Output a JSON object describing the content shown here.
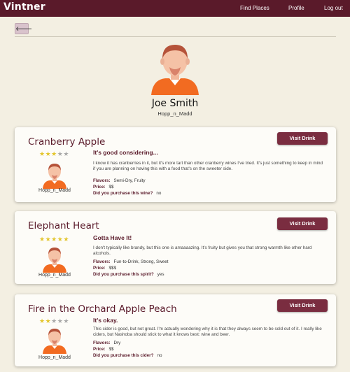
{
  "app": {
    "brand": "Vintner"
  },
  "nav": {
    "find_places": "Find Places",
    "profile": "Profile",
    "logout": "Log out"
  },
  "back_button": {
    "icon": "arrow-left-icon",
    "glyph": "🡐"
  },
  "profile": {
    "name": "Joe Smith",
    "handle": "Hopp_n_Madd"
  },
  "reviews": [
    {
      "drink": "Cranberry Apple",
      "rating": 3,
      "max_rating": 5,
      "user": "Hopp_n_Madd",
      "visit_label": "Visit Drink",
      "review_title": "It's good considering...",
      "review_body": "I know it has cranberries in it, but it's more tart than other cranberry wines I've tried. It's just something to keep in mind if you are planning on having this with a food that's on the sweeter side.",
      "flavors_label": "Flavors:",
      "flavors": "Semi-Dry, Fruity",
      "price_label": "Price:",
      "price": "$$",
      "purchase_label": "Did you purchase this wine?",
      "purchased": "no"
    },
    {
      "drink": "Elephant Heart",
      "rating": 5,
      "max_rating": 5,
      "user": "Hopp_n_Madd",
      "visit_label": "Visit Drink",
      "review_title": "Gotta Have It!",
      "review_body": "I don't typically like brandy, but this one is amaaaazing. It's fruity but gives you that strong warmth like other hard alcohols.",
      "flavors_label": "Flavors:",
      "flavors": "Fun-to-Drink, Strong, Sweet",
      "price_label": "Price:",
      "price": "$$$",
      "purchase_label": "Did you purchase this spirit?",
      "purchased": "yes"
    },
    {
      "drink": "Fire in the Orchard Apple Peach",
      "rating": 2,
      "max_rating": 5,
      "user": "Hopp_n_Madd",
      "visit_label": "Visit Drink",
      "review_title": "It's okay.",
      "review_body": "This cider is good, but not great. I'm actually wondering why it is that they always seem to be sold out of it. I really like ciders, but Nashoba should stick to what it knows best: wine and beer.",
      "flavors_label": "Flavors:",
      "flavors": "Dry",
      "price_label": "Price:",
      "price": "$$",
      "purchase_label": "Did you purchase this cider?",
      "purchased": "no"
    }
  ],
  "colors": {
    "navbar": "#5a1a2a",
    "accent": "#7a2d40",
    "background": "#f3efe2",
    "star_on": "#e3c52c",
    "star_off": "#a9a9a9"
  }
}
